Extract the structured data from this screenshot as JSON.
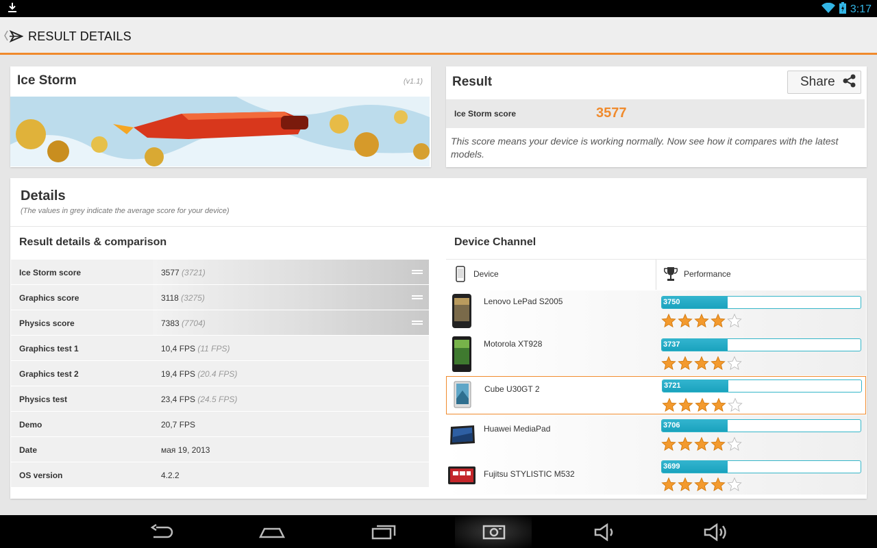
{
  "status_bar": {
    "time": "3:17",
    "icons": [
      "download-icon",
      "wifi-icon",
      "battery-icon"
    ]
  },
  "action_bar": {
    "title": "RESULT DETAILS"
  },
  "benchmark": {
    "name": "Ice Storm",
    "version": "(v1.1)"
  },
  "result": {
    "title": "Result",
    "share_label": "Share",
    "score_label": "Ice Storm score",
    "score_value": "3577",
    "description": "This score means your device is working normally. Now see how it compares with the latest models."
  },
  "details": {
    "title": "Details",
    "subtitle": "(The values in grey indicate the average score for your device)",
    "left_title": "Result details & comparison",
    "rows": [
      {
        "label": "Ice Storm score",
        "value": "3577",
        "avg": "(3721)",
        "expandable": true
      },
      {
        "label": "Graphics score",
        "value": "3118",
        "avg": "(3275)",
        "expandable": true
      },
      {
        "label": "Physics score",
        "value": "7383",
        "avg": "(7704)",
        "expandable": true
      },
      {
        "label": "Graphics test 1",
        "value": "10,4 FPS",
        "avg": "(11 FPS)",
        "expandable": false
      },
      {
        "label": "Graphics test 2",
        "value": "19,4 FPS",
        "avg": "(20.4 FPS)",
        "expandable": false
      },
      {
        "label": "Physics test",
        "value": "23,4 FPS",
        "avg": "(24.5 FPS)",
        "expandable": false
      },
      {
        "label": "Demo",
        "value": "20,7 FPS",
        "avg": "",
        "expandable": false
      },
      {
        "label": "Date",
        "value": "мая 19, 2013",
        "avg": "",
        "expandable": false
      },
      {
        "label": "OS version",
        "value": "4.2.2",
        "avg": "",
        "expandable": false
      }
    ]
  },
  "device_channel": {
    "title": "Device Channel",
    "col_device": "Device",
    "col_performance": "Performance",
    "devices": [
      {
        "name": "Lenovo LePad S2005",
        "score": "3750",
        "fill": 0.33,
        "stars": 4,
        "selected": false
      },
      {
        "name": "Motorola XT928",
        "score": "3737",
        "fill": 0.33,
        "stars": 4,
        "selected": false
      },
      {
        "name": "Cube U30GT 2",
        "score": "3721",
        "fill": 0.33,
        "stars": 4,
        "selected": true
      },
      {
        "name": "Huawei MediaPad",
        "score": "3706",
        "fill": 0.33,
        "stars": 4,
        "selected": false
      },
      {
        "name": "Fujitsu STYLISTIC M532",
        "score": "3699",
        "fill": 0.33,
        "stars": 4,
        "selected": false
      }
    ]
  },
  "colors": {
    "accent": "#f08a2c",
    "bar": "#1aa3be",
    "star": "#f39a2e"
  },
  "nav_bar": {
    "buttons": [
      "back-icon",
      "home-icon",
      "recents-icon",
      "screenshot-icon",
      "volume-down-icon",
      "volume-up-icon"
    ]
  }
}
